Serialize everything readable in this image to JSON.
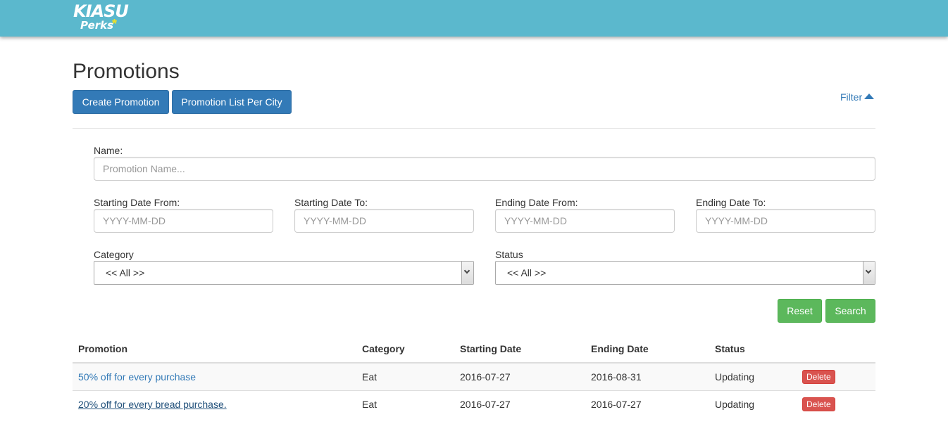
{
  "header": {
    "logo_line1": "KIASU",
    "logo_line2": "Perks",
    "logo_star": "*",
    "bg_color": "#5bb8cd"
  },
  "page": {
    "title": "Promotions",
    "create_button": "Create Promotion",
    "per_city_button": "Promotion List Per City",
    "filter_link": "Filter",
    "filter_icon": "caret-up-icon"
  },
  "filter": {
    "name_label": "Name:",
    "name_placeholder": "Promotion Name...",
    "start_from_label": "Starting Date From:",
    "start_from_placeholder": "YYYY-MM-DD",
    "start_to_label": "Starting Date To:",
    "start_to_placeholder": "YYYY-MM-DD",
    "end_from_label": "Ending Date From:",
    "end_from_placeholder": "YYYY-MM-DD",
    "end_to_label": "Ending Date To:",
    "end_to_placeholder": "YYYY-MM-DD",
    "category_label": "Category",
    "category_value": "<< All >>",
    "status_label": "Status",
    "status_value": "<< All >>",
    "reset_button": "Reset",
    "search_button": "Search"
  },
  "table": {
    "columns": [
      "Promotion",
      "Category",
      "Starting Date",
      "Ending Date",
      "Status",
      ""
    ],
    "rows": [
      {
        "promotion": "50% off for every purchase",
        "category": "Eat",
        "start": "2016-07-27",
        "end": "2016-08-31",
        "status": "Updating",
        "action": "Delete"
      },
      {
        "promotion": "20% off for every bread purchase.",
        "category": "Eat",
        "start": "2016-07-27",
        "end": "2016-07-27",
        "status": "Updating",
        "action": "Delete"
      }
    ]
  }
}
